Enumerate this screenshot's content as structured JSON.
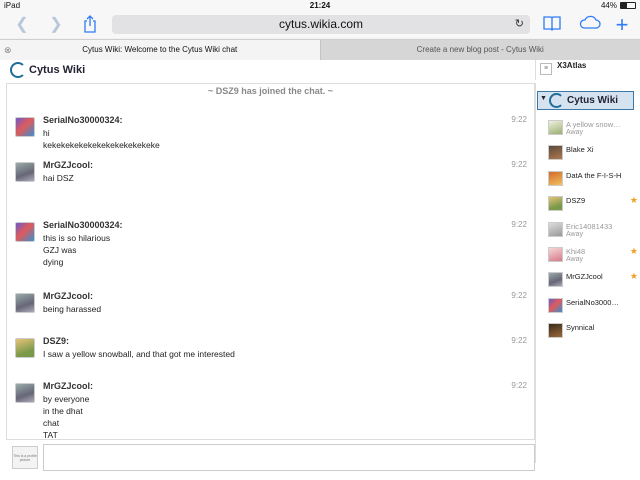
{
  "status": {
    "device": "iPad",
    "time": "21:24",
    "battery": "44%",
    "battery_fraction": 0.44
  },
  "browser": {
    "url": "cytus.wikia.com",
    "icons": [
      "back-icon",
      "forward-icon",
      "share-icon",
      "reload-icon",
      "bookmarks-icon",
      "icloud-tabs-icon",
      "new-tab-icon"
    ],
    "tabs": [
      {
        "title": "Cytus Wiki: Welcome to the Cytus Wiki chat",
        "active": true
      },
      {
        "title": "Create a new blog post - Cytus Wiki",
        "active": false
      }
    ]
  },
  "header": {
    "logo_text": "Cytus Wiki",
    "current_user": "X3Atlas"
  },
  "chat": {
    "join_notice": "~ DSZ9 has joined the chat. ~",
    "messages": [
      {
        "user": "SerialNo30000324:",
        "time": "9:22",
        "avatar": "serial",
        "lines": [
          "hi",
          "kekekekekekekekekekekekeke"
        ]
      },
      {
        "user": "MrGZJcool:",
        "time": "9:22",
        "avatar": "mrg",
        "lines": [
          "hai DSZ"
        ]
      },
      {
        "user": "SerialNo30000324:",
        "time": "9:22",
        "avatar": "serial",
        "lines": [
          "this is so hilarious",
          "GZJ was",
          "dying"
        ]
      },
      {
        "user": "MrGZJcool:",
        "time": "9:22",
        "avatar": "mrg",
        "lines": [
          "being harassed"
        ]
      },
      {
        "user": "DSZ9:",
        "time": "9:22",
        "avatar": "dsz",
        "lines": [
          "I saw a yellow snowball, and that got me interested"
        ]
      },
      {
        "user": "MrGZJcool:",
        "time": "9:22",
        "avatar": "mrg",
        "lines": [
          "by everyone",
          "in the dhat",
          "chat",
          "TAT"
        ]
      }
    ],
    "self_avatar_text": "This is a profile picture"
  },
  "userlist": {
    "title": "Cytus Wiki",
    "users": [
      {
        "name": "A yellow snow…",
        "status": "Away",
        "avatar": "snow",
        "away": true,
        "star": false
      },
      {
        "name": "Blake Xi",
        "status": "",
        "avatar": "blake",
        "away": false,
        "star": false
      },
      {
        "name": "DatA the F-I-S-H",
        "status": "",
        "avatar": "data",
        "away": false,
        "star": false
      },
      {
        "name": "DSZ9",
        "status": "",
        "avatar": "dsz",
        "away": false,
        "star": true
      },
      {
        "name": "Eric14081433",
        "status": "Away",
        "avatar": "eric",
        "away": true,
        "star": false
      },
      {
        "name": "Khi48",
        "status": "Away",
        "avatar": "khi",
        "away": true,
        "star": true
      },
      {
        "name": "MrGZJcool",
        "status": "",
        "avatar": "mrg",
        "away": false,
        "star": true
      },
      {
        "name": "SerialNo3000…",
        "status": "",
        "avatar": "serial",
        "away": false,
        "star": false
      },
      {
        "name": "Synnical",
        "status": "",
        "avatar": "syn",
        "away": false,
        "star": false
      }
    ]
  }
}
